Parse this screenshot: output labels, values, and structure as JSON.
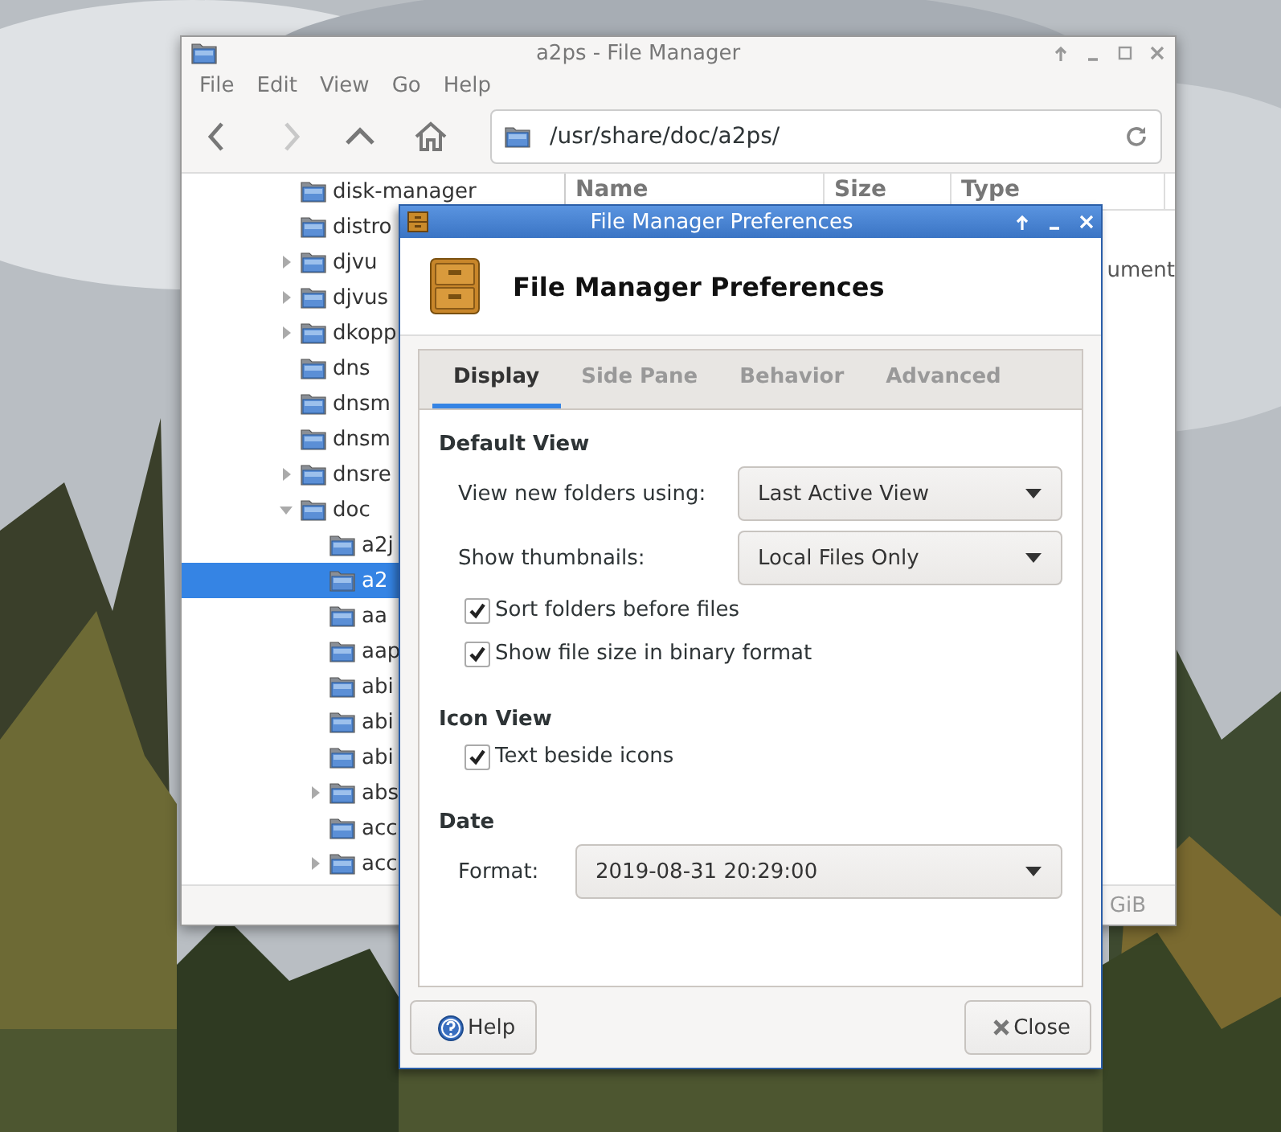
{
  "file_manager": {
    "title": "a2ps - File Manager",
    "menu": [
      "File",
      "Edit",
      "View",
      "Go",
      "Help"
    ],
    "toolbar": [
      {
        "kind": "back",
        "disabled": false
      },
      {
        "kind": "forward",
        "disabled": true
      },
      {
        "kind": "up",
        "disabled": false
      },
      {
        "kind": "home",
        "disabled": false
      }
    ],
    "location": "/usr/share/doc/a2ps/",
    "tree": [
      {
        "label": "disk-manager",
        "selected": false
      },
      {
        "label": "distro",
        "selected": false
      },
      {
        "label": "djvu",
        "expanded": false,
        "selected": false
      },
      {
        "label": "djvus",
        "expanded": false,
        "selected": false
      },
      {
        "label": "dkopp",
        "expanded": false,
        "selected": false
      },
      {
        "label": "dns",
        "selected": false
      },
      {
        "label": "dnsm",
        "selected": false
      },
      {
        "label": "dnsm",
        "selected": false
      },
      {
        "label": "dnsre",
        "expanded": false,
        "selected": false
      },
      {
        "label": "doc",
        "expanded": true,
        "selected": false,
        "children": [
          {
            "label": "a2j",
            "selected": false
          },
          {
            "label": "a2",
            "selected": true
          },
          {
            "label": "aa",
            "selected": false
          },
          {
            "label": "aap",
            "selected": false
          },
          {
            "label": "abi",
            "selected": false
          },
          {
            "label": "abi",
            "selected": false
          },
          {
            "label": "abi",
            "selected": false
          },
          {
            "label": "abs",
            "expanded": false,
            "selected": false
          },
          {
            "label": "acc",
            "selected": false
          },
          {
            "label": "acc",
            "expanded": false,
            "selected": false
          }
        ]
      }
    ],
    "columns": [
      "Name",
      "Size",
      "Type"
    ],
    "type_cell_fragment": "ument",
    "status_fragment": "GiB"
  },
  "preferences": {
    "title": "File Manager Preferences",
    "heading": "File Manager Preferences",
    "tabs": [
      {
        "label": "Display",
        "selected": true
      },
      {
        "label": "Side Pane",
        "selected": false
      },
      {
        "label": "Behavior",
        "selected": false
      },
      {
        "label": "Advanced",
        "selected": false
      }
    ],
    "sections": [
      {
        "heading": "Default View",
        "rows": [
          {
            "kind": "dropdown",
            "label": "View new folders using:",
            "value": "Last Active View"
          },
          {
            "kind": "dropdown",
            "label": "Show thumbnails:",
            "value": "Local Files Only"
          },
          {
            "kind": "checkbox",
            "label": "Sort folders before files",
            "checked": true
          },
          {
            "kind": "checkbox",
            "label": "Show file size in binary format",
            "checked": true
          }
        ]
      },
      {
        "heading": "Icon View",
        "rows": [
          {
            "kind": "checkbox",
            "label": "Text beside icons",
            "checked": true
          }
        ]
      },
      {
        "heading": "Date",
        "rows": [
          {
            "kind": "wide_dropdown",
            "label": "Format:",
            "value": "2019-08-31 20:29:00"
          }
        ]
      }
    ],
    "buttons": [
      {
        "kind": "help",
        "label": "Help"
      },
      {
        "kind": "close",
        "label": "Close"
      }
    ]
  }
}
